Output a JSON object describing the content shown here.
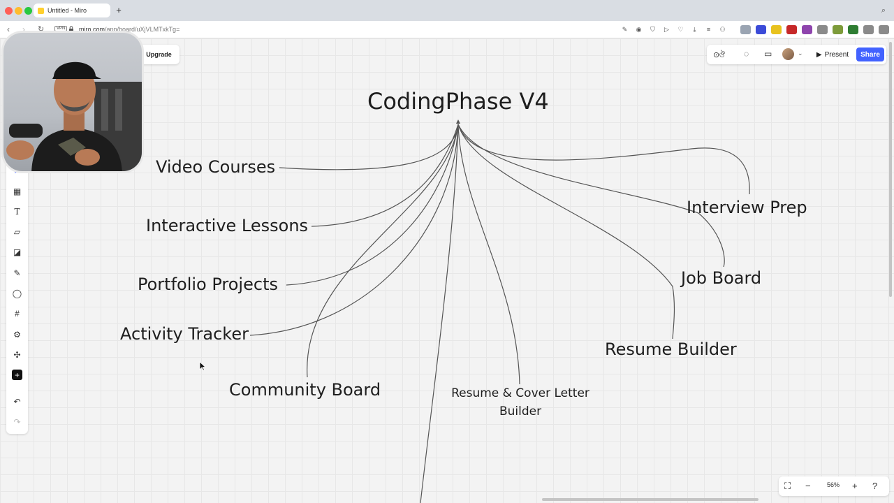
{
  "browser": {
    "tab_title": "Untitled - Miro",
    "new_tab_glyph": "+",
    "url_domain": "miro.com",
    "url_path": "/app/board/uXjVLMTxkTg=",
    "vpn_label": "VPN"
  },
  "board": {
    "title": "CodingPhase V4",
    "nodes": {
      "video_courses": "Video Courses",
      "interactive_lessons": "Interactive Lessons",
      "portfolio_projects": "Portfolio Projects",
      "activity_tracker": "Activity Tracker",
      "community_board": "Community Board",
      "resume_cover_letter": "Resume & Cover Letter Builder",
      "resume_builder": "Resume Builder",
      "job_board": "Job Board",
      "interview_prep": "Interview Prep"
    },
    "line_color": "#555555"
  },
  "header": {
    "upgrade_label": "Upgrade",
    "present_label": "Present",
    "share_label": "Share",
    "share_color": "#4262ff"
  },
  "zoom": {
    "level": "56%"
  },
  "toolbar_tools": [
    "select-icon",
    "templates-icon",
    "text-icon",
    "sticky-note-icon",
    "shapes-icon",
    "pen-icon",
    "comment-icon",
    "frame-icon",
    "more-apps-icon",
    "connector-icon",
    "add-icon",
    "undo-icon",
    "redo-icon"
  ]
}
